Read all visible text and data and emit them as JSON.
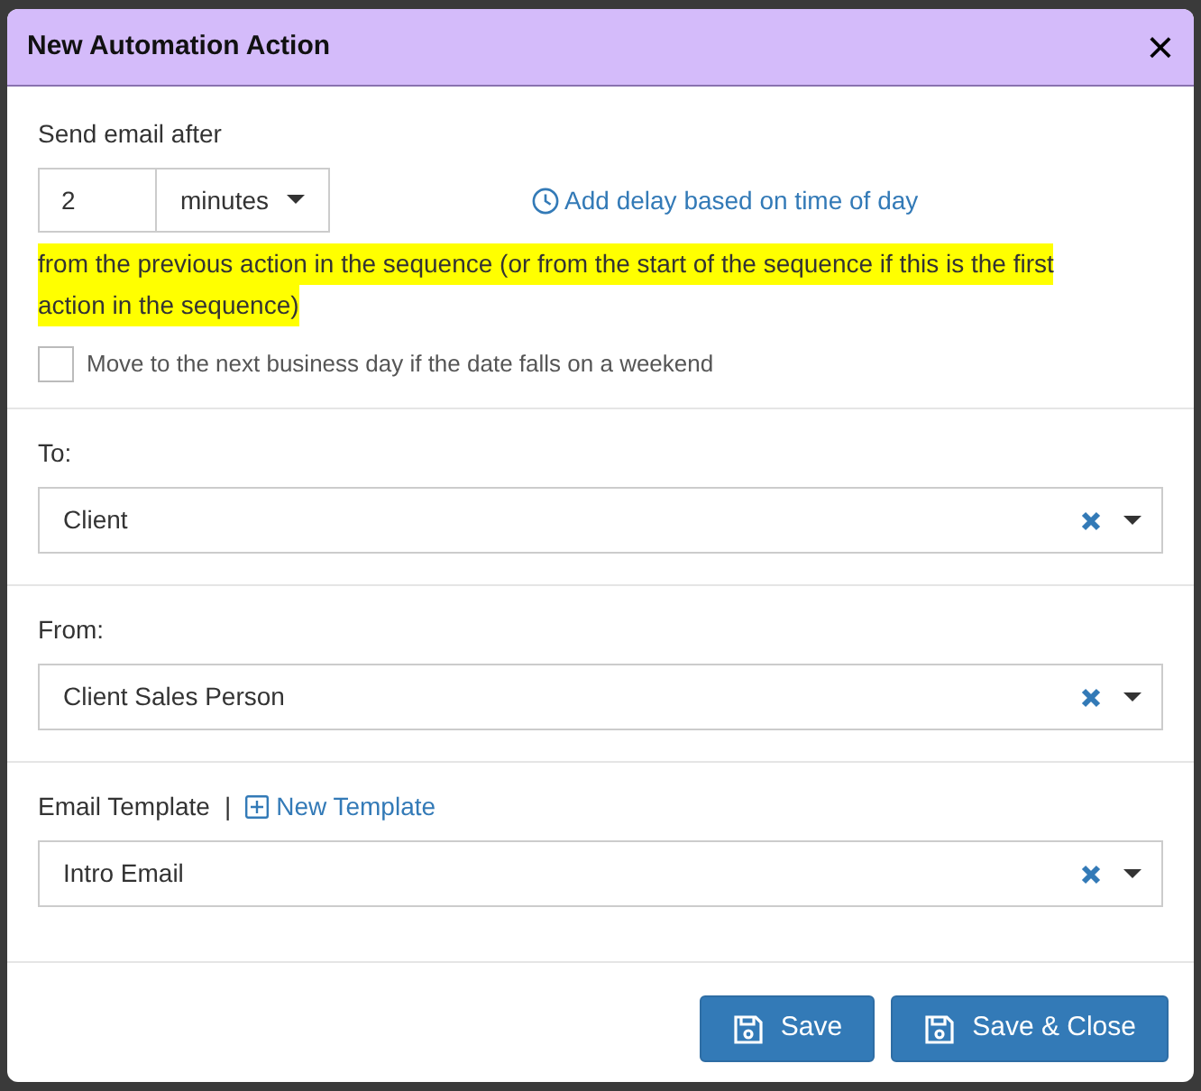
{
  "dialog": {
    "title": "New Automation Action",
    "close": "×"
  },
  "delay": {
    "label": "Send email after",
    "amount": "2",
    "unit": "minutes",
    "time_of_day_link": "Add delay based on time of day",
    "note_lines": [
      "from the previous action in the sequence (or from the start of the sequence if this is the first",
      "action in the sequence)"
    ],
    "weekend_option": {
      "label": "Move to the next business day if the date falls on a weekend",
      "checked": false
    }
  },
  "fields": [
    {
      "label": "To:",
      "value": "Client"
    },
    {
      "label": "From:",
      "value": "Client Sales Person"
    },
    {
      "label": "Email Template",
      "separator": "|",
      "link": "New Template",
      "value": "Intro Email"
    }
  ],
  "buttons": [
    {
      "label": "Save"
    },
    {
      "label": "Save & Close"
    }
  ]
}
